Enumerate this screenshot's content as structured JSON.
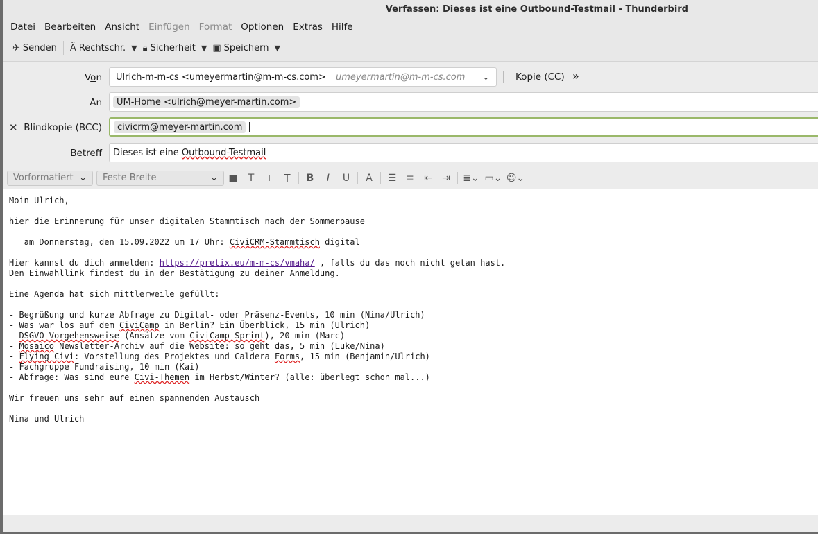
{
  "window": {
    "title": "Verfassen: Dieses ist eine Outbound-Testmail - Thunderbird"
  },
  "menu": {
    "datei": {
      "u": "D",
      "rest": "atei"
    },
    "bearbeiten": {
      "u": "B",
      "rest": "earbeiten"
    },
    "ansicht": {
      "u": "A",
      "rest": "nsicht"
    },
    "einfuegen": {
      "u": "E",
      "rest": "infügen"
    },
    "format": {
      "u": "F",
      "rest": "ormat"
    },
    "optionen": {
      "u": "O",
      "rest": "ptionen"
    },
    "extras_pre": "E",
    "extras_u": "x",
    "extras_post": "tras",
    "hilfe": {
      "u": "H",
      "rest": "ilfe"
    }
  },
  "toolbar": {
    "send": "Senden",
    "spell": "Rechtschr.",
    "security": "Sicherheit",
    "save": "Speichern"
  },
  "header": {
    "from_label_pre": "V",
    "from_label_u": "o",
    "from_label_post": "n",
    "from_name": "Ulrich-m-m-cs <umeyermartin@m-m-cs.com>",
    "from_identity": "umeyermartin@m-m-cs.com",
    "cc_button": "Kopie (CC)",
    "to_label": "An",
    "to_recipient": "UM-Home <ulrich@meyer-martin.com>",
    "bcc_label": "Blindkopie (BCC)",
    "bcc_recipient": "civicrm@meyer-martin.com",
    "subject_label_pre": "Bet",
    "subject_label_u": "r",
    "subject_label_post": "eff",
    "subject_pre": "Dieses ist eine ",
    "subject_spell": "Outbound-Testmail"
  },
  "format": {
    "paragraph": "Vorformatiert",
    "font": "Feste Breite"
  },
  "body": {
    "l1": "Moin Ulrich,",
    "l2": "hier die Erinnerung für unser digitalen Stammtisch nach der Sommerpause",
    "l3_pre": "   am Donnerstag, den 15.09.2022 um 17 Uhr: ",
    "l3_spell": "CiviCRM-Stammtisch",
    "l3_post": " digital",
    "l4_pre": "Hier kannst du dich anmelden: ",
    "l4_link": "https://pretix.eu/m-m-cs/vmaha/",
    "l4_post": " , falls du das noch nicht getan hast.",
    "l5": "Den Einwahllink findest du in der Bestätigung zu deiner Anmeldung.",
    "l6": "Eine Agenda hat sich mittlerweile gefüllt:",
    "a1": "- Begrüßung und kurze Abfrage zu Digital- oder Präsenz-Events, 10 min (Nina/Ulrich)",
    "a2_pre": "- Was war los auf dem ",
    "a2_spell": "CiviCamp",
    "a2_post": " in Berlin? Ein Überblick, 15 min (Ulrich)",
    "a3_pre": "- ",
    "a3_spell1": "DSGVO-Vorgehensweise",
    "a3_mid": " (Ansätze vom ",
    "a3_spell2": "CiviCamp-Sprint",
    "a3_post": "), 20 min (Marc)",
    "a4_pre": "- ",
    "a4_spell": "Mosaico",
    "a4_post": " Newsletter-Archiv auf die Website: so geht das, 5 min (Luke/Nina)",
    "a5_pre": "- ",
    "a5_spell1": "Flying Civi",
    "a5_mid": ": Vorstellung des Projektes und Caldera ",
    "a5_spell2": "Forms",
    "a5_post": ", 15 min (Benjamin/Ulrich)",
    "a6": "- Fachgruppe Fundraising, 10 min (Kai)",
    "a7_pre": "- Abfrage: Was sind eure ",
    "a7_spell": "Civi-Themen",
    "a7_post": " im Herbst/Winter? (alle: überlegt schon mal...)",
    "l7": "Wir freuen uns sehr auf einen spannenden Austausch",
    "l8": "Nina und Ulrich"
  },
  "icons": {
    "send": "paper-plane-icon",
    "spell": "spellcheck-icon",
    "security": "lock-icon",
    "save": "save-icon"
  }
}
